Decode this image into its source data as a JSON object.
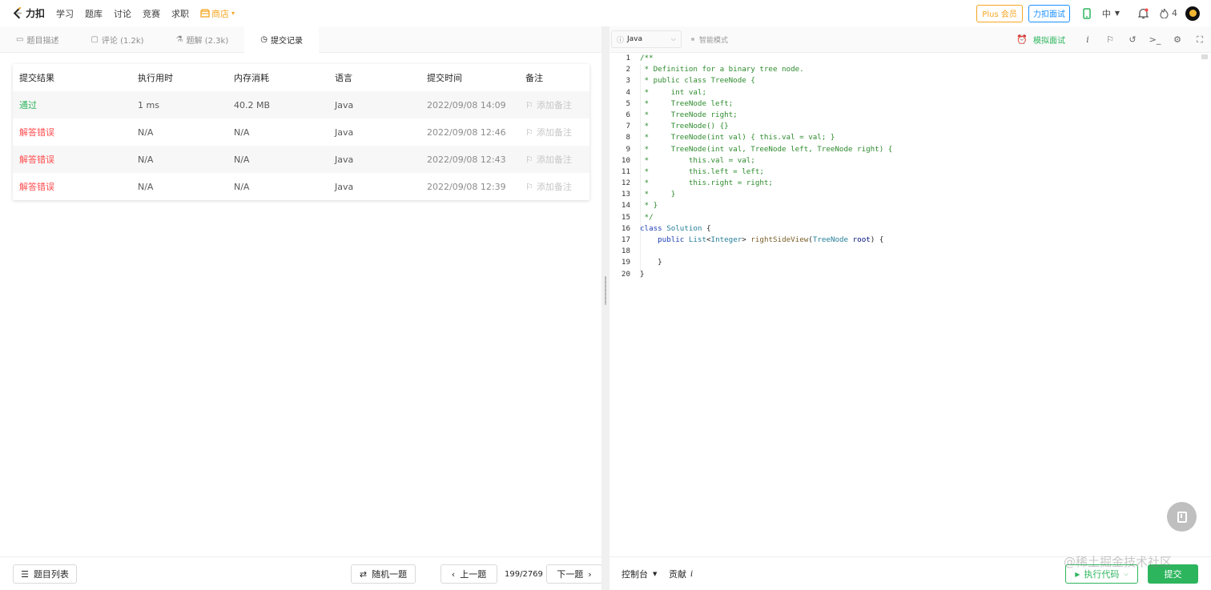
{
  "nav": {
    "logo_text": "力扣",
    "items": [
      "学习",
      "题库",
      "讨论",
      "竞赛",
      "求职"
    ],
    "shop": "商店",
    "plus_member": "Plus 会员",
    "interview": "力扣面试",
    "lang": "中",
    "streak": "4"
  },
  "tabs": [
    {
      "label": "题目描述",
      "icon": "description-icon"
    },
    {
      "label": "评论 (1.2k)",
      "icon": "comment-icon"
    },
    {
      "label": "题解 (2.3k)",
      "icon": "flask-icon"
    },
    {
      "label": "提交记录",
      "icon": "clock-icon",
      "active": true
    }
  ],
  "submissions": {
    "headers": [
      "提交结果",
      "执行用时",
      "内存消耗",
      "语言",
      "提交时间",
      "备注"
    ],
    "rows": [
      {
        "result": "通过",
        "status": "ok",
        "runtime": "1 ms",
        "memory": "40.2 MB",
        "lang": "Java",
        "time": "2022/09/08 14:09",
        "note": "添加备注"
      },
      {
        "result": "解答错误",
        "status": "err",
        "runtime": "N/A",
        "memory": "N/A",
        "lang": "Java",
        "time": "2022/09/08 12:46",
        "note": "添加备注"
      },
      {
        "result": "解答错误",
        "status": "err",
        "runtime": "N/A",
        "memory": "N/A",
        "lang": "Java",
        "time": "2022/09/08 12:43",
        "note": "添加备注"
      },
      {
        "result": "解答错误",
        "status": "err",
        "runtime": "N/A",
        "memory": "N/A",
        "lang": "Java",
        "time": "2022/09/08 12:39",
        "note": "添加备注"
      }
    ]
  },
  "left_footer": {
    "problem_list": "题目列表",
    "random": "随机一题",
    "prev": "上一题",
    "page": "199/2769",
    "next": "下一题"
  },
  "editor": {
    "language": "Java",
    "smart_mode": "智能模式",
    "mock_interview": "模拟面试",
    "code_lines": [
      [
        [
          "/**",
          "c-com"
        ]
      ],
      [
        [
          " * Definition for a binary tree node.",
          "c-com"
        ]
      ],
      [
        [
          " * public class TreeNode {",
          "c-com"
        ]
      ],
      [
        [
          " *     int val;",
          "c-com"
        ]
      ],
      [
        [
          " *     TreeNode left;",
          "c-com"
        ]
      ],
      [
        [
          " *     TreeNode right;",
          "c-com"
        ]
      ],
      [
        [
          " *     TreeNode() {}",
          "c-com"
        ]
      ],
      [
        [
          " *     TreeNode(int val) { this.val = val; }",
          "c-com"
        ]
      ],
      [
        [
          " *     TreeNode(int val, TreeNode left, TreeNode right) {",
          "c-com"
        ]
      ],
      [
        [
          " *         this.val = val;",
          "c-com"
        ]
      ],
      [
        [
          " *         this.left = left;",
          "c-com"
        ]
      ],
      [
        [
          " *         this.right = right;",
          "c-com"
        ]
      ],
      [
        [
          " *     }",
          "c-com"
        ]
      ],
      [
        [
          " * }",
          "c-com"
        ]
      ],
      [
        [
          " */",
          "c-com"
        ]
      ],
      [
        [
          "class ",
          "c-kw"
        ],
        [
          "Solution",
          "c-ty"
        ],
        [
          " {",
          "c-pl"
        ]
      ],
      [
        [
          "    public ",
          "c-kw"
        ],
        [
          "List",
          "c-ty"
        ],
        [
          "<",
          "c-pl"
        ],
        [
          "Integer",
          "c-ty"
        ],
        [
          "> ",
          "c-pl"
        ],
        [
          "rightSideView",
          "c-fn"
        ],
        [
          "(",
          "c-pl"
        ],
        [
          "TreeNode ",
          "c-ty"
        ],
        [
          "root",
          "c-pa"
        ],
        [
          ") {",
          "c-pl"
        ]
      ],
      [
        [
          "",
          "c-pl"
        ]
      ],
      [
        [
          "    }",
          "c-pl"
        ]
      ],
      [
        [
          "}",
          "c-pl"
        ]
      ]
    ]
  },
  "editor_footer": {
    "console": "控制台",
    "contribute": "贡献",
    "contribute_icon": "i",
    "run": "执行代码",
    "submit": "提交"
  },
  "watermark": "@稀土掘金技术社区"
}
